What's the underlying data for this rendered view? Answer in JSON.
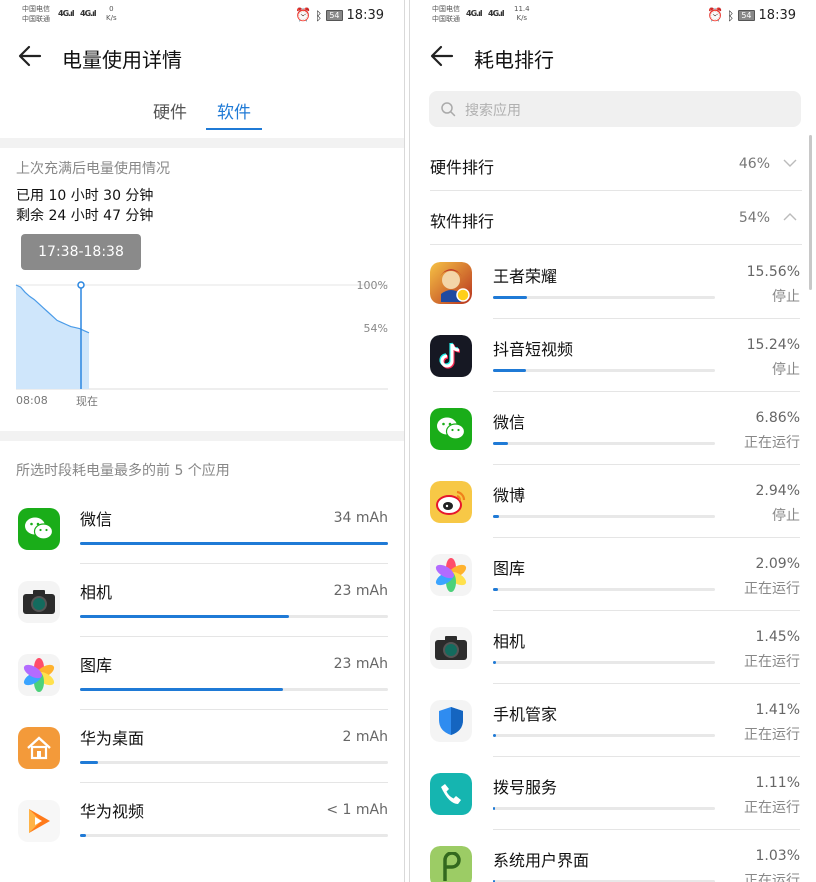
{
  "left": {
    "status": {
      "carrier1": "中国电信",
      "carrier2": "中国联通",
      "sig1": "4G",
      "sig2": "4G",
      "speed_val": "0",
      "speed_unit": "K/s",
      "battery": "54",
      "time": "18:39"
    },
    "title": "电量使用详情",
    "tabs": [
      {
        "label": "硬件",
        "active": false
      },
      {
        "label": "软件",
        "active": true
      }
    ],
    "since_label": "上次充满后电量使用情况",
    "used": "已用 10 小时 30 分钟",
    "remaining": "剩余 24 小时 47 分钟",
    "chart_data": {
      "type": "area",
      "tooltip": "17:38-18:38",
      "x_start_label": "08:08",
      "x_now_label": "现在",
      "y_labels": [
        "100%",
        "54%"
      ],
      "levels_percent": [
        100,
        98,
        93,
        89,
        86,
        82,
        78,
        74,
        70,
        66,
        64,
        62,
        60,
        59,
        58,
        56,
        54
      ],
      "ylim": [
        0,
        100
      ]
    },
    "top_label": "所选时段耗电量最多的前 5 个应用",
    "apps": [
      {
        "name": "微信",
        "value": "34 mAh",
        "fraction": 1.0,
        "icon": "wechat-icon"
      },
      {
        "name": "相机",
        "value": "23 mAh",
        "fraction": 0.68,
        "icon": "camera-icon"
      },
      {
        "name": "图库",
        "value": "23 mAh",
        "fraction": 0.66,
        "icon": "gallery-icon"
      },
      {
        "name": "华为桌面",
        "value": "2 mAh",
        "fraction": 0.06,
        "icon": "home-launcher-icon"
      },
      {
        "name": "华为视频",
        "value": "< 1 mAh",
        "fraction": 0.02,
        "icon": "video-icon"
      }
    ]
  },
  "right": {
    "status": {
      "carrier1": "中国电信",
      "carrier2": "中国联通",
      "sig1": "4G",
      "sig2": "4G",
      "speed_val": "11.4",
      "speed_unit": "K/s",
      "battery": "54",
      "time": "18:39"
    },
    "title": "耗电排行",
    "search_placeholder": "搜索应用",
    "hardware": {
      "label": "硬件排行",
      "pct": "46%"
    },
    "software": {
      "label": "软件排行",
      "pct": "54%"
    },
    "apps": [
      {
        "name": "王者荣耀",
        "pct": "15.56%",
        "state": "停止",
        "fraction": 0.155,
        "icon": "honor-of-kings-icon"
      },
      {
        "name": "抖音短视频",
        "pct": "15.24%",
        "state": "停止",
        "fraction": 0.152,
        "icon": "douyin-icon"
      },
      {
        "name": "微信",
        "pct": "6.86%",
        "state": "正在运行",
        "fraction": 0.069,
        "icon": "wechat-icon"
      },
      {
        "name": "微博",
        "pct": "2.94%",
        "state": "停止",
        "fraction": 0.029,
        "icon": "weibo-icon"
      },
      {
        "name": "图库",
        "pct": "2.09%",
        "state": "正在运行",
        "fraction": 0.021,
        "icon": "gallery-icon"
      },
      {
        "name": "相机",
        "pct": "1.45%",
        "state": "正在运行",
        "fraction": 0.015,
        "icon": "camera-icon"
      },
      {
        "name": "手机管家",
        "pct": "1.41%",
        "state": "正在运行",
        "fraction": 0.014,
        "icon": "phone-manager-icon"
      },
      {
        "name": "拨号服务",
        "pct": "1.11%",
        "state": "正在运行",
        "fraction": 0.011,
        "icon": "dialer-icon"
      },
      {
        "name": "系统用户界面",
        "pct": "1.03%",
        "state": "正在运行",
        "fraction": 0.01,
        "icon": "system-ui-icon"
      }
    ]
  }
}
